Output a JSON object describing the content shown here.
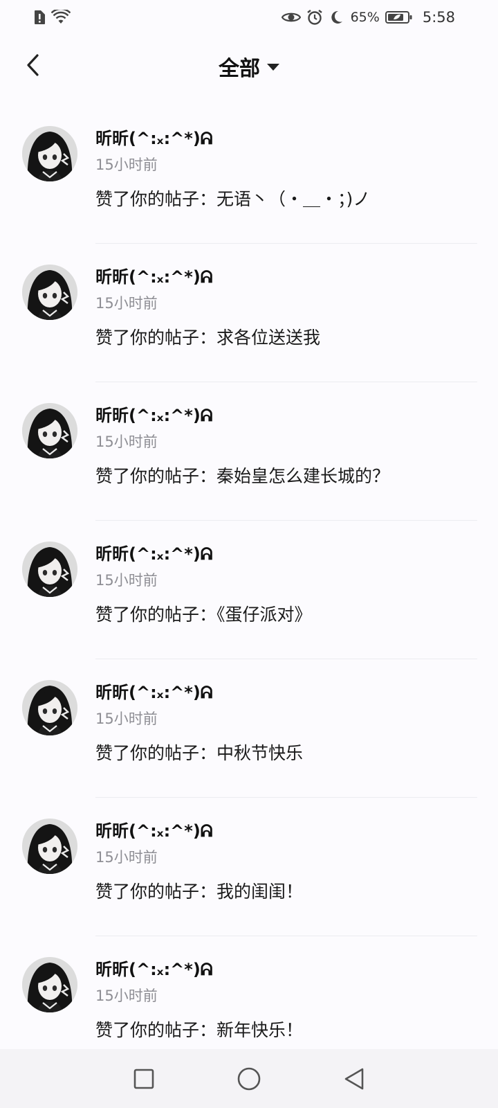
{
  "status_bar": {
    "battery_percent": "65%",
    "time": "5:58",
    "icons_left": [
      "alert-sim-icon",
      "wifi-icon"
    ],
    "icons_right": [
      "eye-icon",
      "alarm-icon",
      "moon-icon",
      "battery-icon"
    ]
  },
  "header": {
    "title": "全部",
    "back_icon": "chevron-left-icon",
    "dropdown_icon": "caret-down-icon"
  },
  "notifications": [
    {
      "user": "昕昕(^:ₓ:^*)ᕱ",
      "time": "15小时前",
      "message": "赞了你的帖子：无语丶（・＿・；)ノ"
    },
    {
      "user": "昕昕(^:ₓ:^*)ᕱ",
      "time": "15小时前",
      "message": "赞了你的帖子：求各位送送我"
    },
    {
      "user": "昕昕(^:ₓ:^*)ᕱ",
      "time": "15小时前",
      "message": "赞了你的帖子：秦始皇怎么建长城的？"
    },
    {
      "user": "昕昕(^:ₓ:^*)ᕱ",
      "time": "15小时前",
      "message": "赞了你的帖子：《蛋仔派对》"
    },
    {
      "user": "昕昕(^:ₓ:^*)ᕱ",
      "time": "15小时前",
      "message": "赞了你的帖子：中秋节快乐"
    },
    {
      "user": "昕昕(^:ₓ:^*)ᕱ",
      "time": "15小时前",
      "message": "赞了你的帖子：我的闺闺！"
    },
    {
      "user": "昕昕(^:ₓ:^*)ᕱ",
      "time": "15小时前",
      "message": "赞了你的帖子：新年快乐！"
    }
  ],
  "nav_bar": {
    "icons": [
      "square-recents-icon",
      "circle-home-icon",
      "triangle-back-icon"
    ]
  },
  "colors": {
    "background": "#fcfbfe",
    "muted_text": "#8e8e94",
    "divider": "#ececf0"
  }
}
